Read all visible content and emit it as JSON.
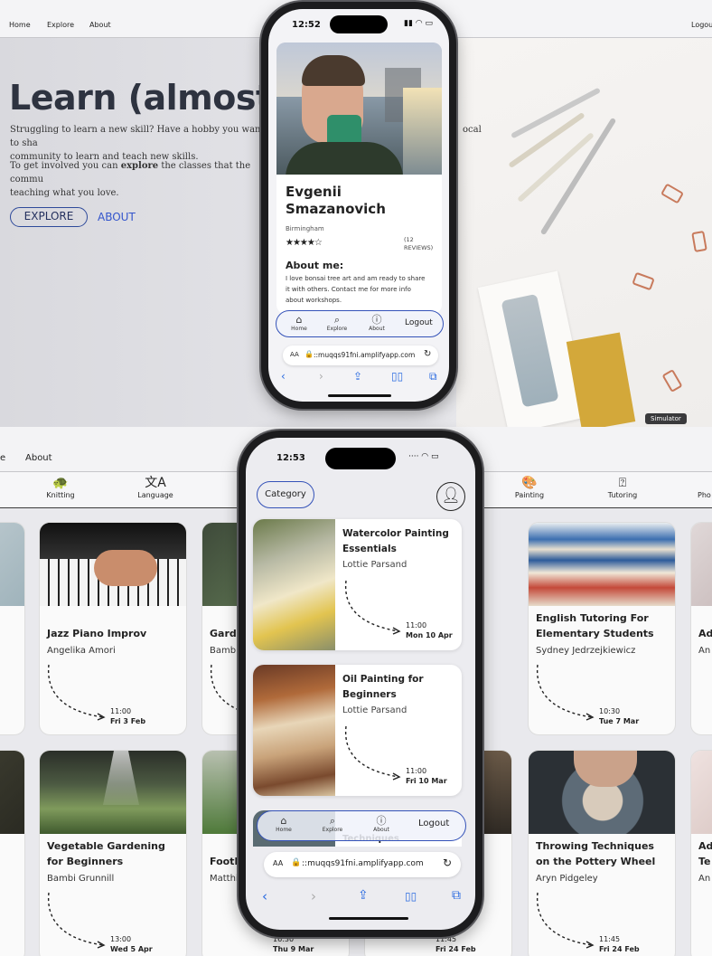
{
  "top_browser": {
    "nav": {
      "home": "Home",
      "explore": "Explore",
      "about": "About",
      "logout": "Logou"
    },
    "hero_title": "Learn (almost) ar",
    "hero_p1": "Struggling to learn a new skill? Have a hobby you want to sha",
    "hero_p1_line2": "community to learn and teach new skills.",
    "hero_p1_tail": "ocal",
    "hero_p2_a": "To get involved you can ",
    "hero_p2_bold": "explore",
    "hero_p2_b": " the classes that the commu",
    "hero_p2_line2": "teaching what you love.",
    "explore_btn": "EXPLORE",
    "about_btn": "ABOUT",
    "simulator_label": "Simulator"
  },
  "phone1": {
    "time": "12:52",
    "profile_name_1": "Evgenii",
    "profile_name_2": "Smazanovich",
    "location": "Birmingham",
    "stars": "★★★★☆",
    "reviews": "(12",
    "reviews_2": "REVIEWS)",
    "about_heading": "About me:",
    "about_text_1": "I love bonsai tree art and am ready to share",
    "about_text_2": "it with others. Contact me for more info",
    "about_text_3": "about workshops.",
    "nav": {
      "home": "Home",
      "explore": "Explore",
      "about": "About",
      "logout": "Logout"
    },
    "url_aa": "AA",
    "url": "::muqqs91fni.amplifyapp.com"
  },
  "bottom_browser": {
    "nav": {
      "left_fragment": "e",
      "about": "About"
    },
    "categories": [
      "Knitting",
      "Language",
      "Painting",
      "Tutoring",
      "Pho"
    ],
    "cards": [
      {
        "title": "Jazz Piano Improv",
        "author": "Angelika Amori",
        "time": "11:00",
        "date": "Fri 3 Feb"
      },
      {
        "title": "Gard",
        "author": "Bamb",
        "time": "",
        "date": ""
      },
      {
        "title": "English Tutoring For Elementary Students",
        "author": "Sydney Jedrzejkiewicz",
        "time": "10:30",
        "date": "Tue 7 Mar"
      },
      {
        "title": "Ad",
        "author": "An",
        "time": "",
        "date": ""
      },
      {
        "title": "Vegetable Gardening for Beginners",
        "author": "Bambi Grunnill",
        "time": "13:00",
        "date": "Wed 5 Apr"
      },
      {
        "title": "Footb",
        "author": "Matthi",
        "time": "16:30",
        "date": "Thu 9 Mar"
      },
      {
        "title": "",
        "author": "",
        "time": "11:45",
        "date": "Fri 24 Feb"
      },
      {
        "title": "Throwing Techniques on the Pottery Wheel",
        "author": "Aryn Pidgeley",
        "time": "11:45",
        "date": "Fri 24 Feb"
      },
      {
        "title": "Ad Te",
        "author": "An",
        "time": "",
        "date": ""
      }
    ]
  },
  "phone2": {
    "time": "12:53",
    "category_btn": "Category",
    "cards": [
      {
        "title": "Watercolor Painting Essentials",
        "author": "Lottie Parsand",
        "time": "11:00",
        "date": "Mon 10 Apr"
      },
      {
        "title": "Oil Painting for Beginners",
        "author": "Lottie Parsand",
        "time": "11:00",
        "date": "Fri 10 Mar"
      }
    ],
    "partial_text": "Techniques",
    "nav": {
      "home": "Home",
      "explore": "Explore",
      "about": "About",
      "logout": "Logout"
    },
    "url_aa": "AA",
    "url": "::muqqs91fni.amplifyapp.com"
  }
}
